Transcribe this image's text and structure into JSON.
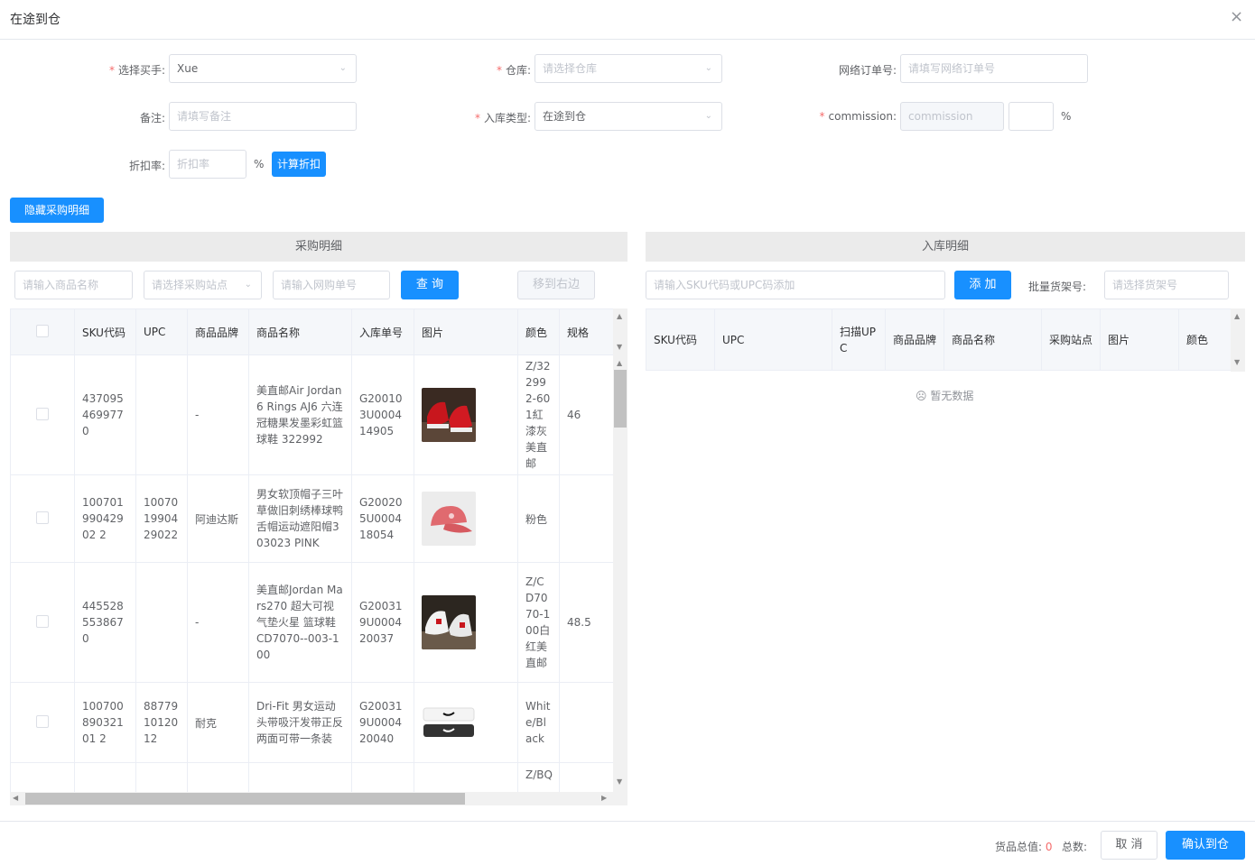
{
  "dialog": {
    "title": "在途到仓",
    "close": "×"
  },
  "form": {
    "buyer": {
      "label": "选择买手:",
      "value": "Xue"
    },
    "warehouse": {
      "label": "仓库:",
      "placeholder": "请选择仓库"
    },
    "net_order": {
      "label": "网络订单号:",
      "placeholder": "请填写网络订单号"
    },
    "remark": {
      "label": "备注:",
      "placeholder": "请填写备注"
    },
    "stock_type": {
      "label": "入库类型:",
      "value": "在途到仓"
    },
    "commission": {
      "label": "commission:",
      "placeholder": "commission",
      "pct": "%"
    },
    "discount": {
      "label": "折扣率:",
      "placeholder": "折扣率",
      "pct": "%",
      "calc_button": "计算折扣"
    }
  },
  "toggle_button": "隐藏采购明细",
  "left": {
    "header": "采购明细",
    "search_name_placeholder": "请输入商品名称",
    "site_placeholder": "请选择采购站点",
    "order_placeholder": "请输入网购单号",
    "query_button": "查 询",
    "move_button": "移到右边",
    "columns": [
      "SKU代码",
      "UPC",
      "商品品牌",
      "商品名称",
      "入库单号",
      "图片",
      "颜色",
      "规格"
    ],
    "rows": [
      {
        "sku": "4370954699770",
        "upc": "",
        "brand": "-",
        "name": "美直邮Air Jordan 6 Rings AJ6 六连冠糖果发墨彩虹篮球鞋 322992",
        "order": "G200103U000414905",
        "image": "red-sneaker-image",
        "color": "Z/322992-601紅漆灰美直邮",
        "spec": "46"
      },
      {
        "sku": "10070199042902 2",
        "upc": "100701990429022",
        "brand": "阿迪达斯",
        "name": "男女软顶帽子三叶草做旧刺绣棒球鸭舌帽运动遮阳帽303023 PINK",
        "order": "G200205U000418054",
        "image": "pink-cap-image",
        "color": "粉色",
        "spec": ""
      },
      {
        "sku": "4455285538670",
        "upc": "",
        "brand": "-",
        "name": "美直邮Jordan Mars270 超大可视气垫火星 篮球鞋 CD7070--003-100",
        "order": "G200319U000420037",
        "image": "white-sneaker-image",
        "color": "Z/CD7070-100白红美直邮",
        "spec": "48.5"
      },
      {
        "sku": "10070089032101 2",
        "upc": "887791012012",
        "brand": "耐克",
        "name": "Dri-Fit 男女运动头带吸汗发带正反两面可带一条装",
        "order": "G200319U000420040",
        "image": "headband-image",
        "color": "White/Black",
        "spec": ""
      },
      {
        "sku": "",
        "upc": "",
        "brand": "",
        "name": "",
        "order": "",
        "image": "",
        "color": "Z/BQ",
        "spec": ""
      }
    ]
  },
  "right": {
    "header": "入库明细",
    "sku_placeholder": "请输入SKU代码或UPC码添加",
    "add_button": "添 加",
    "shelf_label": "批量货架号:",
    "shelf_placeholder": "请选择货架号",
    "columns": [
      "SKU代码",
      "UPC",
      "扫描UPC",
      "商品品牌",
      "商品名称",
      "采购站点",
      "图片",
      "颜色"
    ],
    "empty_text": "暂无数据"
  },
  "footer": {
    "total_value_label": "货品总值:",
    "total_value": "0",
    "total_count_label": "总数:",
    "cancel_button": "取 消",
    "confirm_button": "确认到仓"
  }
}
